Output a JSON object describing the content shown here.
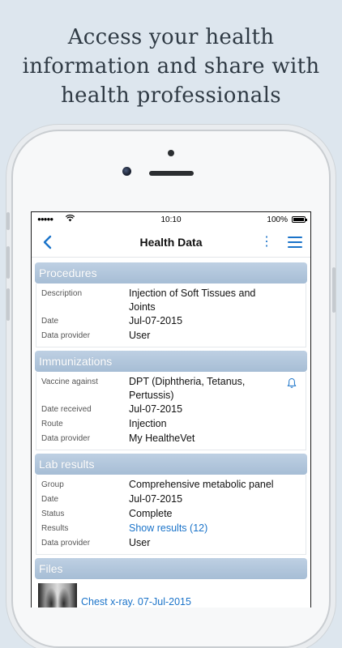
{
  "headline": {
    "line1": "Access your health",
    "line2": "information and share with",
    "line3": "health professionals"
  },
  "status_bar": {
    "signal": "●●●●●",
    "time": "10:10",
    "battery": "100%"
  },
  "nav": {
    "back_icon": "‹",
    "title": "Health Data",
    "more_icon": "⋮"
  },
  "procedures": {
    "title": "Procedures",
    "rows": [
      {
        "label": "Description",
        "value": "Injection of Soft Tissues and Joints"
      },
      {
        "label": "Date",
        "value": "Jul-07-2015"
      },
      {
        "label": "Data provider",
        "value": "User"
      }
    ]
  },
  "immunizations": {
    "title": "Immunizations",
    "rows": [
      {
        "label": "Vaccine against",
        "value": "DPT (Diphtheria, Tetanus, Pertussis)"
      },
      {
        "label": "Date received",
        "value": "Jul-07-2015"
      },
      {
        "label": "Route",
        "value": "Injection"
      },
      {
        "label": "Data provider",
        "value": "My HealtheVet"
      }
    ]
  },
  "lab_results": {
    "title": "Lab results",
    "rows": [
      {
        "label": "Group",
        "value": "Comprehensive metabolic panel"
      },
      {
        "label": "Date",
        "value": "Jul-07-2015"
      },
      {
        "label": "Status",
        "value": "Complete"
      },
      {
        "label": "Results",
        "value": "Show results (12)"
      },
      {
        "label": "Data provider",
        "value": "User"
      }
    ]
  },
  "files": {
    "title": "Files",
    "items": [
      {
        "name": "Chest x-ray. 07-Jul-2015"
      }
    ]
  },
  "colors": {
    "accent": "#1a73c9",
    "section_header": "#b2c6da",
    "background": "#dde6ee"
  }
}
